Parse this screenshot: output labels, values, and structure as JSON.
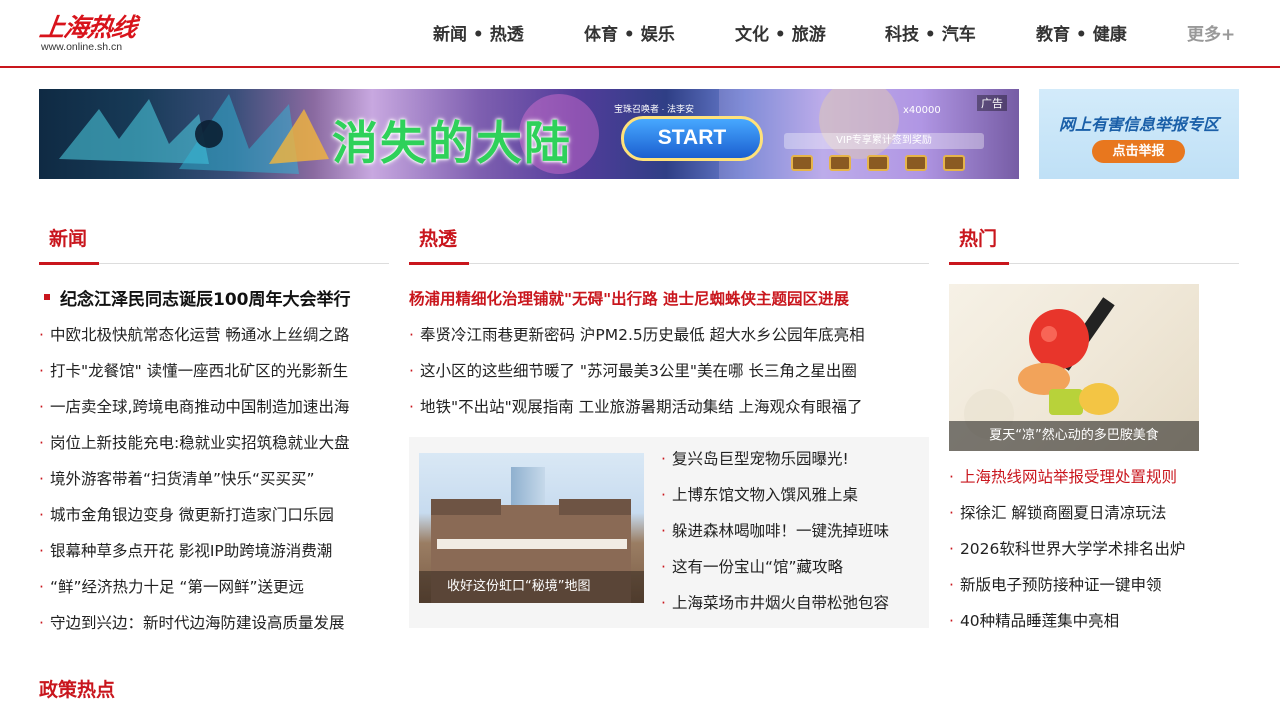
{
  "header": {
    "logo_title": "上海热线",
    "logo_url": "www.online.sh.cn",
    "nav": [
      "新闻 • 热透",
      "体育 • 娱乐",
      "文化 • 旅游",
      "科技 • 汽车",
      "教育 • 健康",
      "更多+"
    ]
  },
  "ad": {
    "title": "消失的大陆",
    "start": "START",
    "small": "宝珠召唤者 · 法李安",
    "vip": "VIP专享累计签到奖励",
    "count": "x40000",
    "label": "广告"
  },
  "report": {
    "title": "网上有害信息举报专区",
    "button": "点击举报"
  },
  "news": {
    "title": "新闻",
    "headline": "纪念江泽民同志诞辰100周年大会举行",
    "items": [
      "中欧北极快航常态化运营 畅通冰上丝绸之路",
      "打卡\"龙餐馆\" 读懂一座西北矿区的光影新生",
      "一店卖全球,跨境电商推动中国制造加速出海",
      "岗位上新技能充电:稳就业实招筑稳就业大盘",
      "境外游客带着“扫货清单”快乐“买买买”",
      "城市金角银边变身 微更新打造家门口乐园",
      "银幕种草多点开花 影视IP助跨境游消费潮",
      "“鲜”经济热力十足 “第一网鲜”送更远",
      "守边到兴边：新时代边海防建设高质量发展"
    ]
  },
  "hot": {
    "title": "热透",
    "headline": "杨浦用精细化治理铺就\"无碍\"出行路 迪士尼蜘蛛侠主题园区进展",
    "items": [
      "奉贤冷江雨巷更新密码 沪PM2.5历史最低 超大水乡公园年底亮相",
      "这小区的这些细节暖了 \"苏河最美3公里\"美在哪 长三角之星出圈",
      "地铁\"不出站\"观展指南 工业旅游暑期活动集结 上海观众有眼福了"
    ],
    "image_caption": "收好这份虹口“秘境”地图",
    "side_items": [
      "复兴岛巨型宠物乐园曝光!",
      "上博东馆文物入馔风雅上桌",
      "躲进森林喝咖啡！一键洗掉班味",
      "这有一份宝山“馆”藏攻略",
      "上海菜场市井烟火自带松弛包容"
    ]
  },
  "popular": {
    "title": "热门",
    "image_caption": "夏天“凉”然心动的多巴胺美食",
    "items": [
      "上海热线网站举报受理处置规则",
      "探徐汇 解锁商圈夏日清凉玩法",
      "2026软科世界大学学术排名出炉",
      "新版电子预防接种证一键申领",
      "40种精品睡莲集中亮相"
    ]
  },
  "policy": {
    "title": "政策热点"
  },
  "colors": {
    "accent": "#c9161d"
  }
}
